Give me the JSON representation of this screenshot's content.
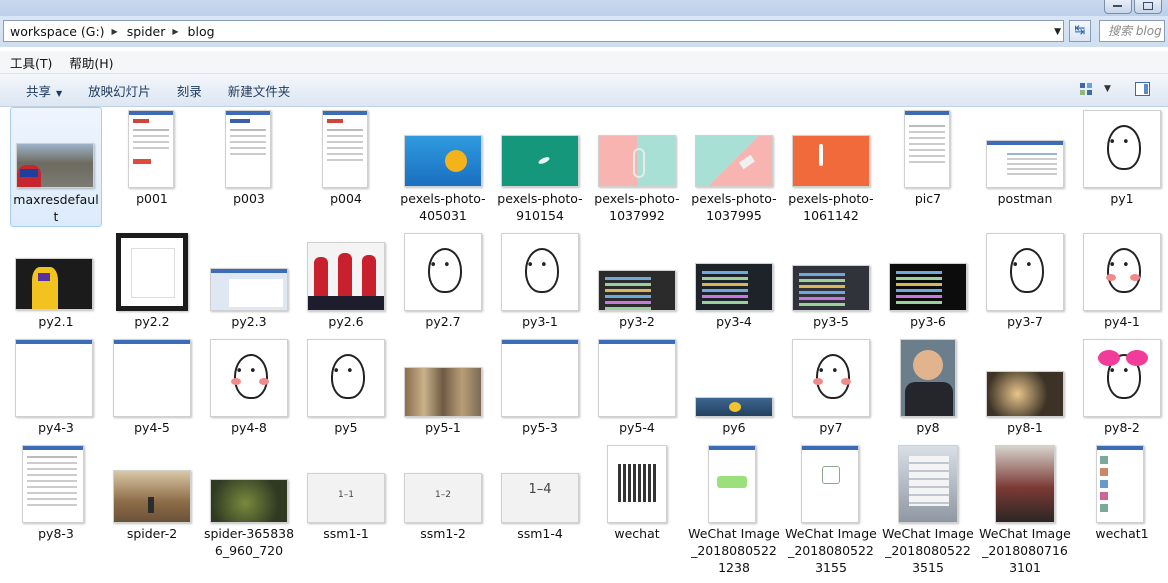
{
  "address": {
    "crumbs": [
      "workspace (G:)",
      "spider",
      "blog"
    ],
    "search_placeholder": "搜索 blog"
  },
  "menu": [
    "工具(T)",
    "帮助(H)"
  ],
  "commands": {
    "share": "共享",
    "slideshow": "放映幻灯片",
    "burn": "刻录",
    "new_folder": "新建文件夹"
  },
  "files": [
    "maxresdefault",
    "p001",
    "p003",
    "p004",
    "pexels-photo-405031",
    "pexels-photo-910154",
    "pexels-photo-1037992",
    "pexels-photo-1037995",
    "pexels-photo-1061142",
    "pic7",
    "postman",
    "py1",
    "py2.1",
    "py2.2",
    "py2.3",
    "py2.6",
    "py2.7",
    "py3-1",
    "py3-2",
    "py3-4",
    "py3-5",
    "py3-6",
    "py3-7",
    "py4-1",
    "py4-3",
    "py4-5",
    "py4-8",
    "py5",
    "py5-1",
    "py5-3",
    "py5-4",
    "py6",
    "py7",
    "py8",
    "py8-1",
    "py8-2",
    "py8-3",
    "spider-2",
    "spider-3658386_960_720",
    "ssm1-1",
    "ssm1-2",
    "ssm1-4",
    "wechat",
    "WeChat Image_20180805221238",
    "WeChat Image_20180805223155",
    "WeChat Image_20180805223515",
    "WeChat Image_20180807163101",
    "wechat1"
  ],
  "thumb_text": {
    "ssm1_1": "1–1",
    "ssm1_2": "1–2",
    "ssm1_4": "1–4"
  }
}
